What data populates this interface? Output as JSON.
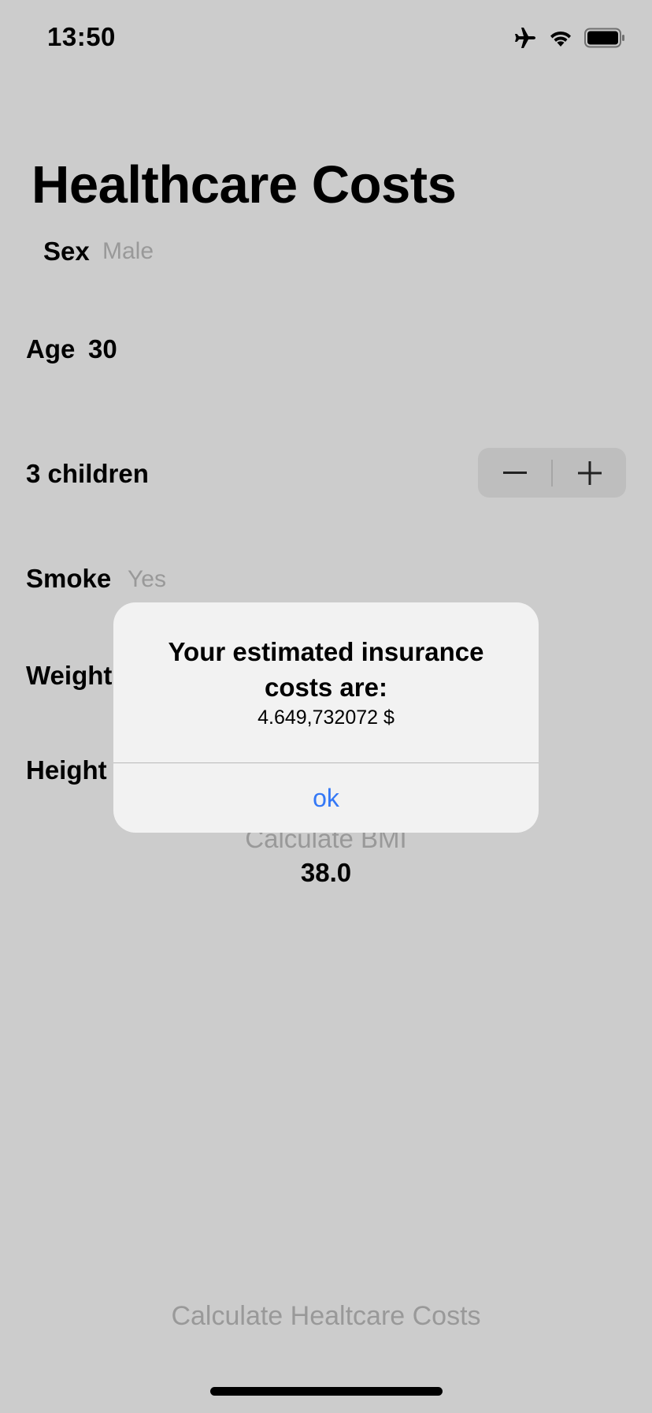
{
  "status_bar": {
    "time": "13:50",
    "icons": [
      "airplane-icon",
      "wifi-icon",
      "battery-icon"
    ]
  },
  "page": {
    "title": "Healthcare Costs"
  },
  "form": {
    "sex": {
      "label": "Sex",
      "value": "Male"
    },
    "age": {
      "label": "Age",
      "value": "30"
    },
    "children": {
      "label": "3 children",
      "stepper_minus": "−",
      "stepper_plus": "+"
    },
    "smoke": {
      "label": "Smoke",
      "value": "Yes"
    },
    "weight": {
      "label": "Weight"
    },
    "height": {
      "label": "Height"
    },
    "bmi": {
      "button_label": "Calculate BMI",
      "value": "38.0"
    },
    "calculate_button": "Calculate Healtcare Costs"
  },
  "alert": {
    "title": "Your estimated insurance costs are:",
    "message": "4.649,732072 $",
    "ok_label": "ok"
  },
  "colors": {
    "background": "#cccccc",
    "accent": "#3478f6",
    "dim_text": "#999999"
  }
}
